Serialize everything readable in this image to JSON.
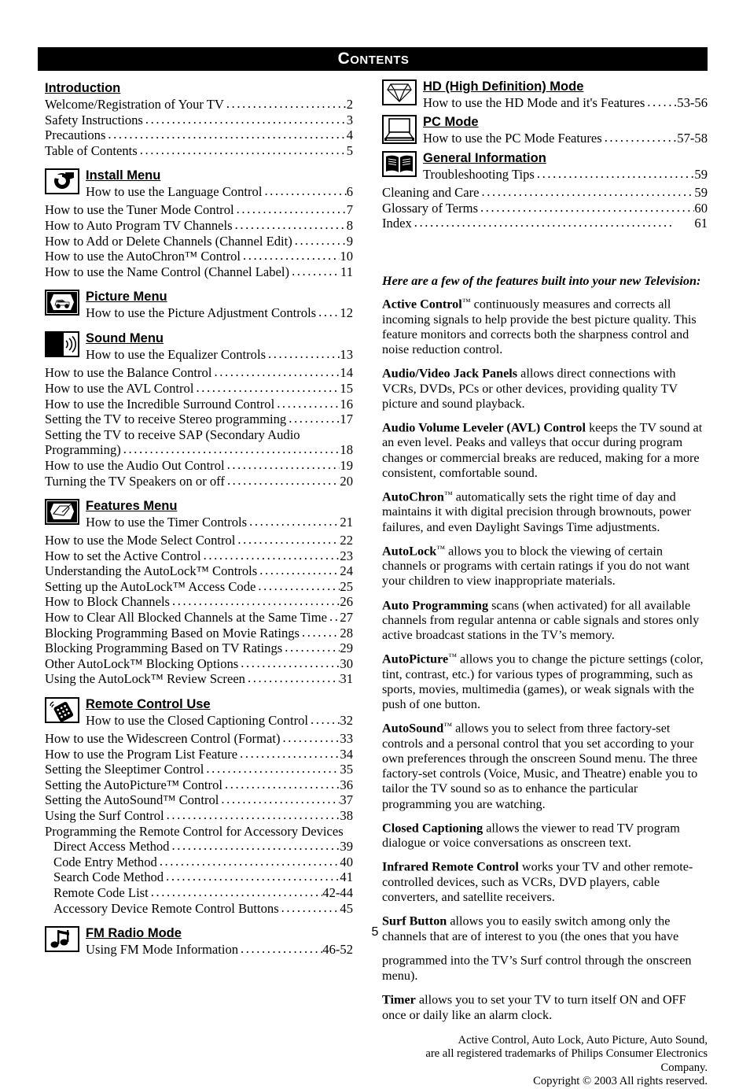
{
  "header": {
    "title": "Contents"
  },
  "page_number": "5",
  "left_column": {
    "sections": [
      {
        "heading": "Introduction",
        "icon": null,
        "rows": [
          {
            "title": "Welcome/Registration of Your TV",
            "page": "2"
          },
          {
            "title": "Safety Instructions",
            "page": "3"
          },
          {
            "title": "Precautions",
            "page": "4"
          },
          {
            "title": "Table of Contents",
            "page": "5"
          }
        ]
      },
      {
        "heading": "Install Menu",
        "icon": "wrench-icon",
        "first_row": {
          "title": "How to use the Language Control",
          "page": "6"
        },
        "rows": [
          {
            "title": "How to use the Tuner Mode Control",
            "page": "7"
          },
          {
            "title": "How to Auto Program TV Channels",
            "page": "8"
          },
          {
            "title": "How to Add or Delete Channels (Channel Edit)",
            "page": "9"
          },
          {
            "title": "How to use the AutoChron™ Control",
            "page": "10"
          },
          {
            "title": "How to use the Name Control (Channel Label)",
            "page": "11"
          }
        ]
      },
      {
        "heading": "Picture Menu",
        "icon": "tv-picture-icon",
        "first_row": {
          "title": "How to use the Picture Adjustment Controls",
          "page": "12"
        },
        "rows": []
      },
      {
        "heading": "Sound Menu",
        "icon": "speaker-icon",
        "first_row": {
          "title": "How to use the Equalizer Controls",
          "page": "13"
        },
        "rows": [
          {
            "title": "How to use the Balance Control",
            "page": "14"
          },
          {
            "title": "How to use the AVL Control",
            "page": "15"
          },
          {
            "title": "How to use the Incredible Surround Control",
            "page": "16"
          },
          {
            "title": "Setting the TV to receive Stereo programming",
            "page": "17"
          },
          {
            "title": "Setting the TV to receive SAP (Secondary Audio",
            "page": "",
            "wrapped_second": "Programming)",
            "page2": "18"
          },
          {
            "title": "How to use the Audio Out Control",
            "page": "19"
          },
          {
            "title": "Turning the TV Speakers on or off",
            "page": "20"
          }
        ]
      },
      {
        "heading": "Features Menu",
        "icon": "tv-hand-icon",
        "first_row": {
          "title": "How to use the Timer Controls",
          "page": "21"
        },
        "rows": [
          {
            "title": "How to use the Mode Select Control",
            "page": "22"
          },
          {
            "title": "How to set the Active Control",
            "page": "23"
          },
          {
            "title": "Understanding the AutoLock™ Controls",
            "page": "24"
          },
          {
            "title": "Setting up the AutoLock™ Access Code",
            "page": "25"
          },
          {
            "title": "How to Block Channels",
            "page": "26"
          },
          {
            "title": "How to Clear All Blocked Channels at the Same Time",
            "page": "27"
          },
          {
            "title": "Blocking Programming Based on Movie Ratings",
            "page": "28"
          },
          {
            "title": "Blocking Programming Based on TV Ratings",
            "page": "29"
          },
          {
            "title": "Other AutoLock™ Blocking Options",
            "page": "30"
          },
          {
            "title": "Using the AutoLock™ Review Screen",
            "page": "31"
          }
        ]
      },
      {
        "heading": "Remote Control Use",
        "icon": "remote-control-icon",
        "first_row": {
          "title": "How to use the Closed Captioning Control",
          "page": "32"
        },
        "rows": [
          {
            "title": "How to use the Widescreen Control (Format)",
            "page": "33"
          },
          {
            "title": "How to use the Program List Feature",
            "page": "34"
          },
          {
            "title": "Setting the Sleeptimer Control",
            "page": "35"
          },
          {
            "title": "Setting the AutoPicture™ Control",
            "page": "36"
          },
          {
            "title": "Setting the AutoSound™ Control",
            "page": "37"
          },
          {
            "title": "Using the Surf Control",
            "page": "38"
          },
          {
            "title": "Programming the Remote Control for Accessory Devices",
            "page": "",
            "no_leader": true
          },
          {
            "title": "Direct Access Method",
            "page": "39",
            "indent": true
          },
          {
            "title": "Code Entry Method",
            "page": "40",
            "indent": true
          },
          {
            "title": "Search Code Method",
            "page": "41",
            "indent": true
          },
          {
            "title": "Remote Code List",
            "page": "42-44",
            "indent": true
          },
          {
            "title": "Accessory Device Remote Control Buttons",
            "page": "45",
            "indent": true
          }
        ]
      },
      {
        "heading": "FM Radio Mode",
        "icon": "music-note-icon",
        "first_row": {
          "title": "Using FM Mode Information",
          "page": "46-52"
        },
        "rows": []
      }
    ]
  },
  "right_column": {
    "sections": [
      {
        "heading": "HD (High Definition) Mode",
        "icon": "diamond-icon",
        "first_row": {
          "title": "How to use the HD Mode and it's Features",
          "page": "53-56"
        },
        "rows": []
      },
      {
        "heading": "PC Mode",
        "icon": "laptop-icon",
        "first_row": {
          "title": "How to use the PC Mode Features",
          "page": "57-58"
        },
        "rows": []
      },
      {
        "heading": "General Information",
        "icon": "open-book-icon",
        "first_row": {
          "title": "Troubleshooting Tips",
          "page": "59"
        },
        "rows": [
          {
            "title": "Cleaning and Care",
            "page": "59"
          },
          {
            "title": "Glossary of Terms",
            "page": "60"
          },
          {
            "title": "Index",
            "page": "61"
          }
        ]
      }
    ],
    "features_intro": "Here are a few of the features built into your new Television:",
    "features": [
      {
        "term": "Active Control",
        "tm": "™",
        "text": " continuously measures and corrects all incoming signals to help provide the best picture quality. This feature monitors and corrects both the sharpness control and noise reduction control."
      },
      {
        "term": "Audio/Video Jack Panels",
        "tm": "",
        "text": " allows direct connections with VCRs, DVDs, PCs or other devices, providing quality TV picture and sound playback."
      },
      {
        "term": "Audio Volume Leveler (AVL) Control",
        "tm": "",
        "text": " keeps the TV sound at an even level.  Peaks and valleys that occur during program changes or commercial breaks are reduced, making for a more consistent, comfortable sound."
      },
      {
        "term": "AutoChron",
        "tm": "™",
        "text": "  automatically sets the right time of day and maintains it with digital precision through brownouts, power failures, and even Daylight Savings Time adjustments."
      },
      {
        "term": "AutoLock",
        "tm": "™",
        "text": " allows you to block the viewing of certain channels or programs with certain ratings if you do not want your children to view inappropriate materials."
      },
      {
        "term": "Auto Programming",
        "tm": "",
        "text": " scans (when activated) for all available channels from regular antenna or cable signals and stores only active broadcast stations in the TV’s memory."
      },
      {
        "term": "AutoPicture",
        "tm": "™",
        "text": " allows you to change the picture settings (color, tint, contrast, etc.) for various types of programming, such as sports, movies, multimedia (games), or weak signals with the push of one button."
      },
      {
        "term": "AutoSound",
        "tm": "™",
        "text": " allows you to select from three factory-set controls and a personal control that you set according to your own preferences through the onscreen Sound menu. The three factory-set controls (Voice, Music, and Theatre) enable you to tailor the TV sound so as to enhance the particular programming you are watching."
      },
      {
        "term": "Closed Captioning",
        "tm": "",
        "text": " allows the viewer to read TV program dialogue or voice conversations as onscreen text."
      },
      {
        "term": "Infrared Remote Control",
        "tm": "",
        "text": " works your  TV and other remote-controlled devices, such as VCRs, DVD players, cable converters, and satellite receivers."
      },
      {
        "term": "Surf Button",
        "tm": "",
        "text": " allows you to easily switch among only the channels that are of interest to you (the ones that you have"
      },
      {
        "term": "",
        "tm": "",
        "text": "programmed into the TV’s Surf control through the onscreen menu)."
      },
      {
        "term": "Timer",
        "tm": "",
        "text": " allows you to set your TV to turn itself ON and OFF once or daily like an alarm clock."
      }
    ],
    "copyright": [
      "Active Control, Auto Lock, Auto Picture, Auto Sound,",
      "are all registered trademarks of Philips Consumer Electronics Company.",
      "Copyright © 2003   All rights reserved."
    ]
  }
}
